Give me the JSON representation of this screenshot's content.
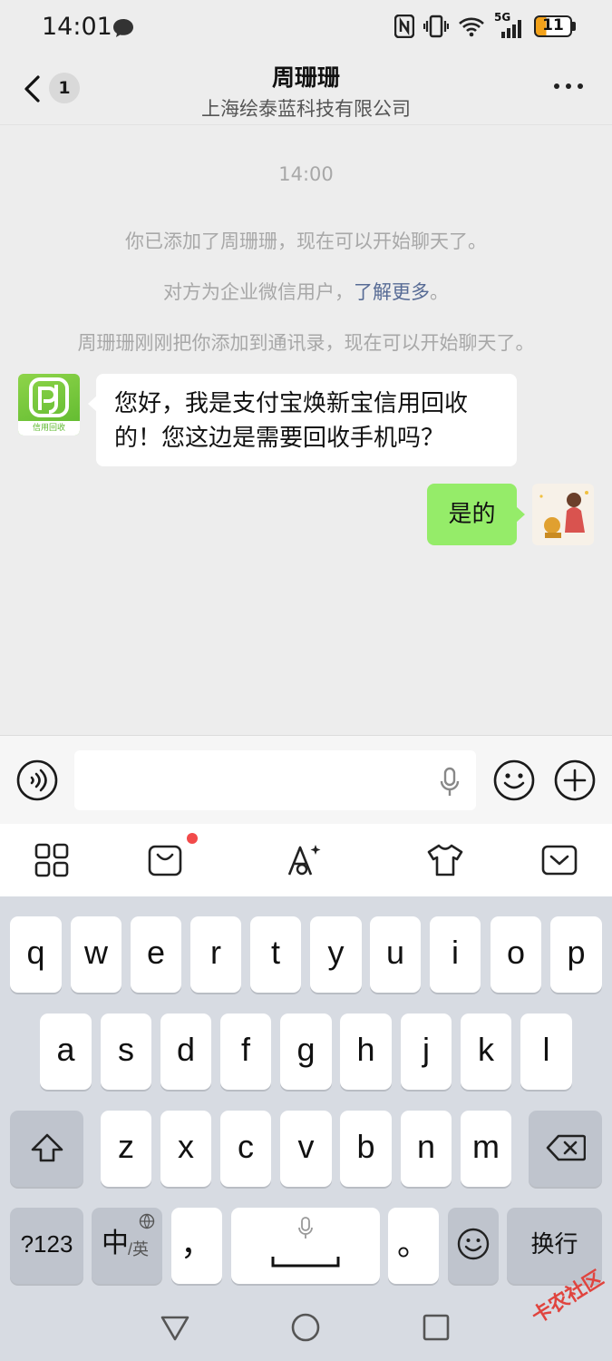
{
  "status_bar": {
    "time": "14:01",
    "battery": "11",
    "network": "5G"
  },
  "header": {
    "unread_count": "1",
    "title": "周珊珊",
    "subtitle": "上海绘泰蓝科技有限公司"
  },
  "chat": {
    "timestamp": "14:00",
    "system_messages": [
      "你已添加了周珊珊，现在可以开始聊天了。",
      "周珊珊刚刚把你添加到通讯录，现在可以开始聊天了。"
    ],
    "enterprise_notice": {
      "text": "对方为企业微信用户，",
      "link": "了解更多",
      "suffix": "。"
    },
    "incoming": {
      "avatar_caption": "信用回收",
      "line1": "您好，我是支付宝焕新宝信用回收",
      "line2": "的！您这边是需要回收手机吗？"
    },
    "outgoing": {
      "text": "是的"
    }
  },
  "input": {
    "value": "",
    "placeholder": ""
  },
  "keyboard": {
    "row1": [
      "q",
      "w",
      "e",
      "r",
      "t",
      "y",
      "u",
      "i",
      "o",
      "p"
    ],
    "row2": [
      "a",
      "s",
      "d",
      "f",
      "g",
      "h",
      "j",
      "k",
      "l"
    ],
    "row3": [
      "z",
      "x",
      "c",
      "v",
      "b",
      "n",
      "m"
    ],
    "numbers_key": "?123",
    "lang_key_main": "中",
    "lang_key_sub": "/英",
    "comma_key": "，",
    "period_key": "。",
    "enter_key": "换行"
  },
  "watermark": "卡农社区",
  "colors": {
    "sent_bubble": "#95ec69",
    "link": "#576b95",
    "notification_dot": "#f24a4a"
  }
}
